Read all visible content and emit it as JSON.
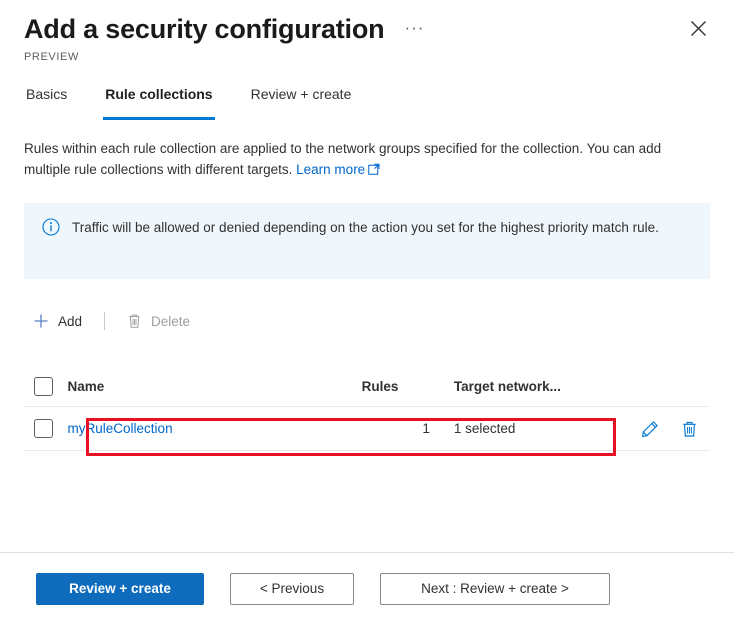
{
  "blade": {
    "title": "Add a security configuration",
    "subtitle": "PREVIEW",
    "more_menu": "···",
    "close_label": "Close"
  },
  "tabs": [
    {
      "label": "Basics",
      "active": false
    },
    {
      "label": "Rule collections",
      "active": true
    },
    {
      "label": "Review + create",
      "active": false
    }
  ],
  "description": {
    "text": "Rules within each rule collection are applied to the network groups specified for the collection. You can add multiple rule collections with different targets.",
    "link_label": "Learn more"
  },
  "info_banner": {
    "icon": "info-circle-icon",
    "text": "Traffic will be allowed or denied depending on the action you set for the highest priority match rule."
  },
  "command_bar": {
    "add_label": "Add",
    "delete_label": "Delete",
    "delete_disabled": true
  },
  "table": {
    "columns": [
      "Name",
      "Rules",
      "Target network..."
    ],
    "rows": [
      {
        "name": "myRuleCollection",
        "rules": "1",
        "target": "1 selected",
        "selected": false
      }
    ]
  },
  "footer": {
    "primary": "Review + create",
    "previous": "< Previous",
    "next": "Next : Review + create >"
  },
  "colors": {
    "accent": "#0078d4",
    "link": "#0066cc",
    "primary_button": "#0f6cbd",
    "info_background": "#eff6fc",
    "annotation": "#e81123"
  }
}
